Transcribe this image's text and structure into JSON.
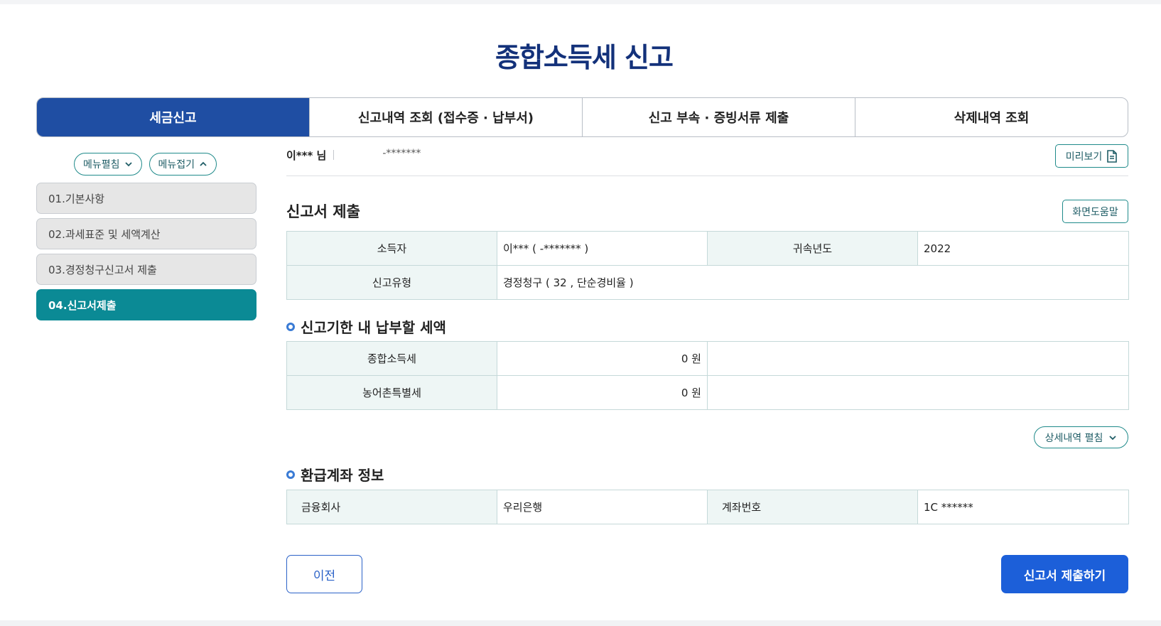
{
  "page_title": "종합소득세 신고",
  "tabs": [
    {
      "label": "세금신고",
      "active": true
    },
    {
      "label": "신고내역 조회 (접수증 · 납부서)",
      "active": false
    },
    {
      "label": "신고 부속 · 증빙서류 제출",
      "active": false
    },
    {
      "label": "삭제내역 조회",
      "active": false
    }
  ],
  "sidebar": {
    "expand_label": "메뉴펼침",
    "collapse_label": "메뉴접기",
    "items": [
      {
        "label": "01.기본사항",
        "active": false
      },
      {
        "label": "02.과세표준 및 세액계산",
        "active": false
      },
      {
        "label": "03.경정청구신고서 제출",
        "active": false
      },
      {
        "label": "04.신고서제출",
        "active": true
      }
    ]
  },
  "user": {
    "name": "이*** 님",
    "masked_id": "-*******"
  },
  "preview_label": "미리보기",
  "section_title": "신고서 제출",
  "help_label": "화면도움말",
  "filing_info": {
    "income_earner_label": "소득자",
    "income_earner_value": "이*** (            -******* )",
    "year_label": "귀속년도",
    "year_value": "2022",
    "type_label": "신고유형",
    "type_value": "경정청구 ( 32 , 단순경비율 )"
  },
  "tax_due": {
    "title": "신고기한 내 납부할 세액",
    "rows": [
      {
        "label": "종합소득세",
        "value": "0 원"
      },
      {
        "label": "농어촌특별세",
        "value": "0 원"
      }
    ]
  },
  "detail_toggle_label": "상세내역 펼침",
  "refund": {
    "title": "환급계좌 정보",
    "bank_label": "금융회사",
    "bank_value": "우리은행",
    "account_label": "계좌번호",
    "account_value": "1C          ******"
  },
  "buttons": {
    "prev": "이전",
    "submit": "신고서 제출하기"
  },
  "colors": {
    "title": "#13317a",
    "tab_active": "#1f4ea3",
    "sidebar_active": "#0b8a95",
    "primary_button": "#1c5fd9",
    "outline_teal": "#1f8a8a"
  }
}
